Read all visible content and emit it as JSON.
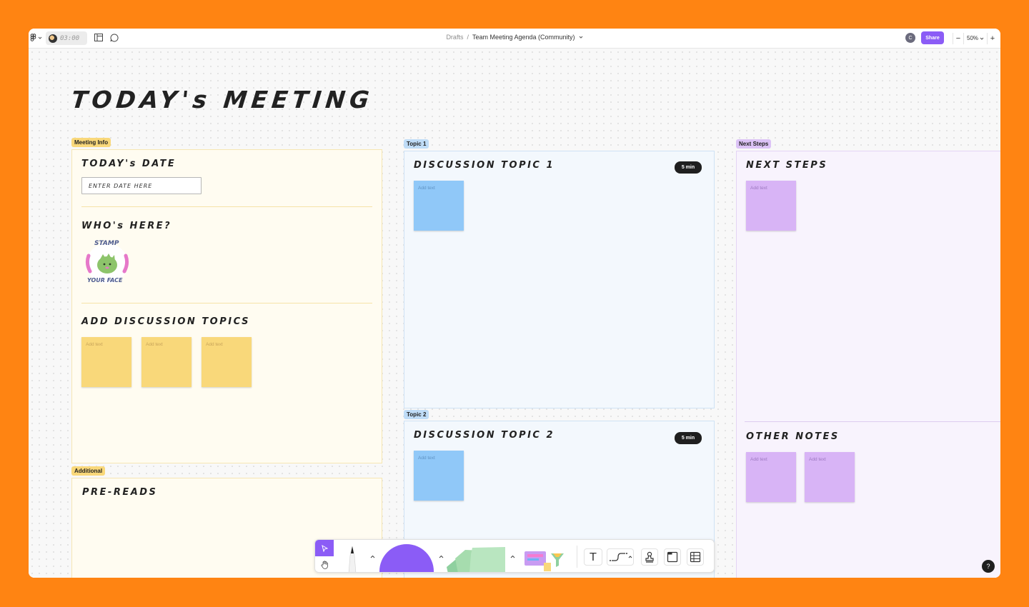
{
  "topbar": {
    "timer": "03:00",
    "breadcrumb_parent": "Drafts",
    "breadcrumb_sep": "/",
    "file_name": "Team Meeting Agenda (Community)",
    "user_initial": "C",
    "share_label": "Share",
    "zoom_level": "50%"
  },
  "board": {
    "title": "TODAY's MEETING",
    "meeting_info": {
      "tag": "Meeting Info",
      "date_heading": "TODAY's DATE",
      "date_placeholder": "ENTER DATE HERE",
      "who_heading": "WHO's HERE?",
      "stamp_top": "STAMP",
      "stamp_bottom": "YOUR FACE",
      "topics_heading": "ADD DISCUSSION TOPICS",
      "stickies": [
        "Add text",
        "Add text",
        "Add text"
      ]
    },
    "additional": {
      "tag": "Additional",
      "heading": "PRE-READS"
    },
    "topic1": {
      "tag": "Topic 1",
      "heading": "DISCUSSION TOPIC 1",
      "duration": "5 min",
      "sticky": "Add text"
    },
    "topic2": {
      "tag": "Topic 2",
      "heading": "DISCUSSION TOPIC 2",
      "duration": "5 min",
      "sticky": "Add text"
    },
    "next_steps": {
      "tag": "Next Steps",
      "heading": "NEXT STEPS",
      "sticky": "Add text",
      "other_heading": "OTHER NOTES",
      "other_stickies": [
        "Add text",
        "Add text"
      ]
    }
  },
  "colors": {
    "yellow_panel": "#fffcf1",
    "yellow_sticky": "#f9d87a",
    "blue_panel": "#f3f8fd",
    "blue_sticky": "#90c8f8",
    "purple_panel": "#f8f3fd",
    "purple_sticky": "#d8b4f6",
    "accent": "#8b5cf6",
    "background": "#ff8412"
  },
  "help_label": "?"
}
